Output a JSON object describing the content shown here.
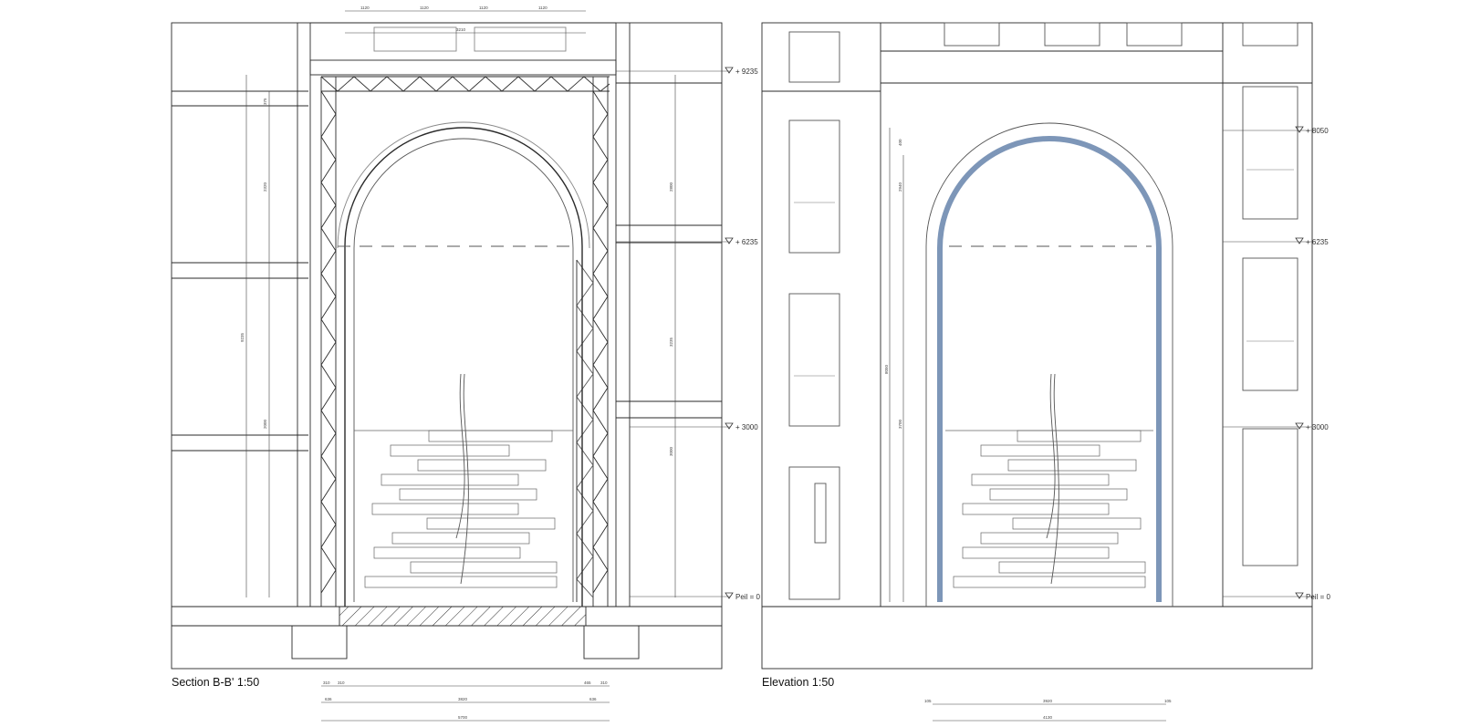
{
  "captions": {
    "section": "Section B-B' 1:50",
    "elevation": "Elevation 1:50"
  },
  "section_levels": [
    "+ 9235",
    "+ 6235",
    "+ 3000",
    "Peil = 0"
  ],
  "elevation_levels": [
    "+ 8050",
    "+ 6235",
    "+ 3000",
    "Peil = 0"
  ],
  "section_dims": {
    "top_row": [
      "1120",
      "1120",
      "1120",
      "1120"
    ],
    "top_total": "3210",
    "bottom_row1": [
      "310",
      "310",
      "465",
      "310"
    ],
    "bottom_row2": [
      "636",
      "3820",
      "636"
    ],
    "bottom_total": "5700",
    "left_vertical": [
      "375",
      "2320",
      "9235",
      "2000"
    ],
    "right_vertical": [
      "2800",
      "3235",
      "3000"
    ]
  },
  "elevation_dims": {
    "bottom_row": [
      "105",
      "3920",
      "105"
    ],
    "bottom_total": "4130",
    "left_vertical": [
      "400",
      "2940",
      "8050",
      "3700"
    ]
  },
  "colors": {
    "line": "#2a2a2a",
    "light_line": "#8a8a8a",
    "arch_blue": "#7d96b8"
  }
}
